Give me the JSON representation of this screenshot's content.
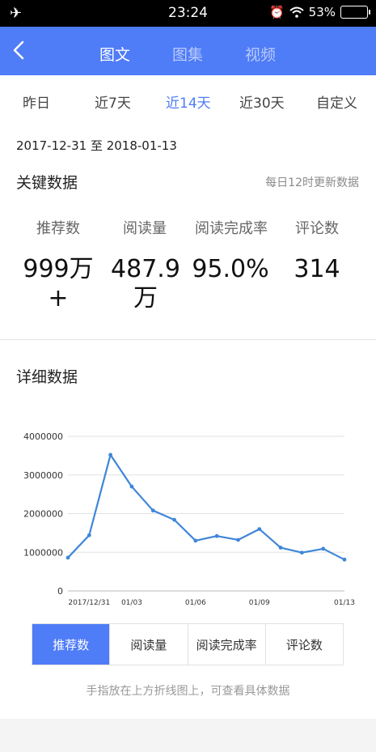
{
  "status_bar": {
    "time": "23:24",
    "battery": "53%"
  },
  "nav": {
    "tabs": [
      "图文",
      "图集",
      "视频"
    ],
    "active_index": 0
  },
  "range_tabs": {
    "items": [
      "昨日",
      "近7天",
      "近14天",
      "近30天",
      "自定义"
    ],
    "active_index": 2
  },
  "date_range": "2017-12-31 至 2018-01-13",
  "key_data": {
    "title": "关键数据",
    "update_note": "每日12时更新数据",
    "metrics": [
      {
        "label": "推荐数",
        "value": "999万\n+"
      },
      {
        "label": "阅读量",
        "value": "487.9\n万"
      },
      {
        "label": "阅读完成率",
        "value": "95.0%"
      },
      {
        "label": "评论数",
        "value": "314"
      }
    ]
  },
  "detail": {
    "title": "详细数据",
    "metric_buttons": [
      "推荐数",
      "阅读量",
      "阅读完成率",
      "评论数"
    ],
    "active_metric": 0,
    "hint": "手指放在上方折线图上，可查看具体数据"
  },
  "colors": {
    "accent": "#4f7cf7",
    "line": "#3f86d8"
  },
  "chart_data": {
    "type": "line",
    "x": [
      "2017/12/31",
      "01/01",
      "01/02",
      "01/03",
      "01/04",
      "01/05",
      "01/06",
      "01/07",
      "01/08",
      "01/09",
      "01/10",
      "01/11",
      "01/12",
      "01/13"
    ],
    "x_tick_labels": [
      "2017/12/31",
      "01/03",
      "01/06",
      "01/09",
      "01/13"
    ],
    "x_tick_indices": [
      1,
      3,
      6,
      9,
      13
    ],
    "y_ticks": [
      "4000000",
      "3000000",
      "2000000",
      "1000000",
      "0"
    ],
    "ylim": [
      0,
      4000000
    ],
    "values": [
      860000,
      1440000,
      3520000,
      2700000,
      2080000,
      1840000,
      1300000,
      1420000,
      1320000,
      1600000,
      1120000,
      990000,
      1090000,
      810000
    ],
    "grid": true
  }
}
